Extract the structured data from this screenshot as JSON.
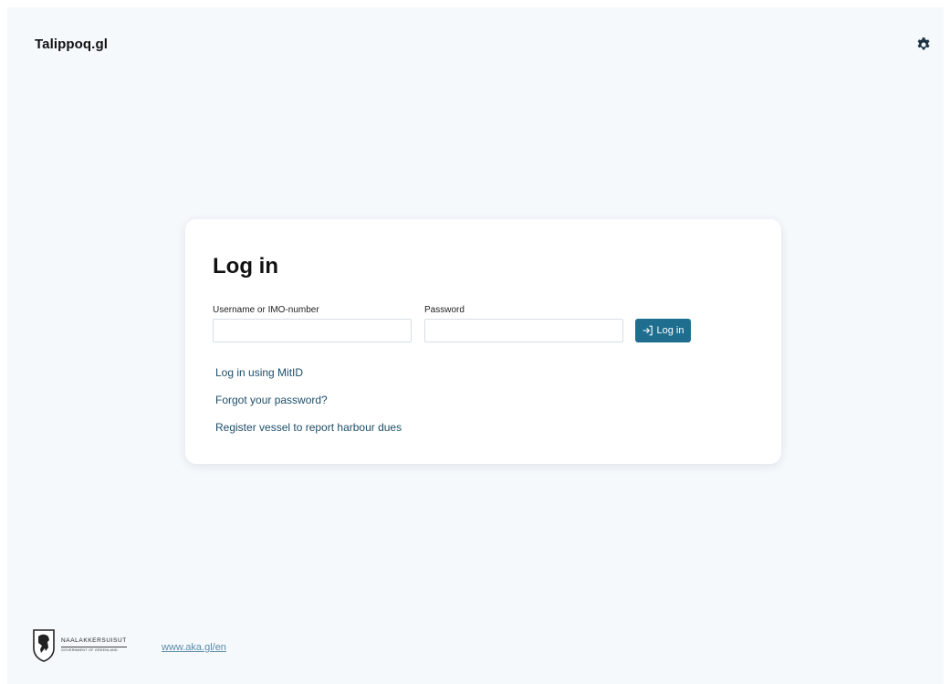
{
  "header": {
    "brand": "Talippoq.gl",
    "settings_icon": "gear-icon"
  },
  "login": {
    "title": "Log in",
    "username_label": "Username or IMO-number",
    "username_value": "",
    "password_label": "Password",
    "password_value": "",
    "submit_label": "Log in",
    "submit_icon": "sign-in-icon",
    "links": {
      "mitid": "Log in using MitID",
      "forgot": "Forgot your password?",
      "register": "Register vessel to report harbour dues"
    }
  },
  "footer": {
    "logo_main": "NAALAKKERSUISUT",
    "logo_sub": "GOVERNMENT OF GREENLAND",
    "logo_icon": "coat-of-arms-icon",
    "link": "www.aka.gl/en"
  },
  "colors": {
    "page_background": "#f5f9fc",
    "primary_button": "#1f6e90",
    "link": "#1d4e6a",
    "footer_link": "#5b8ba8"
  }
}
